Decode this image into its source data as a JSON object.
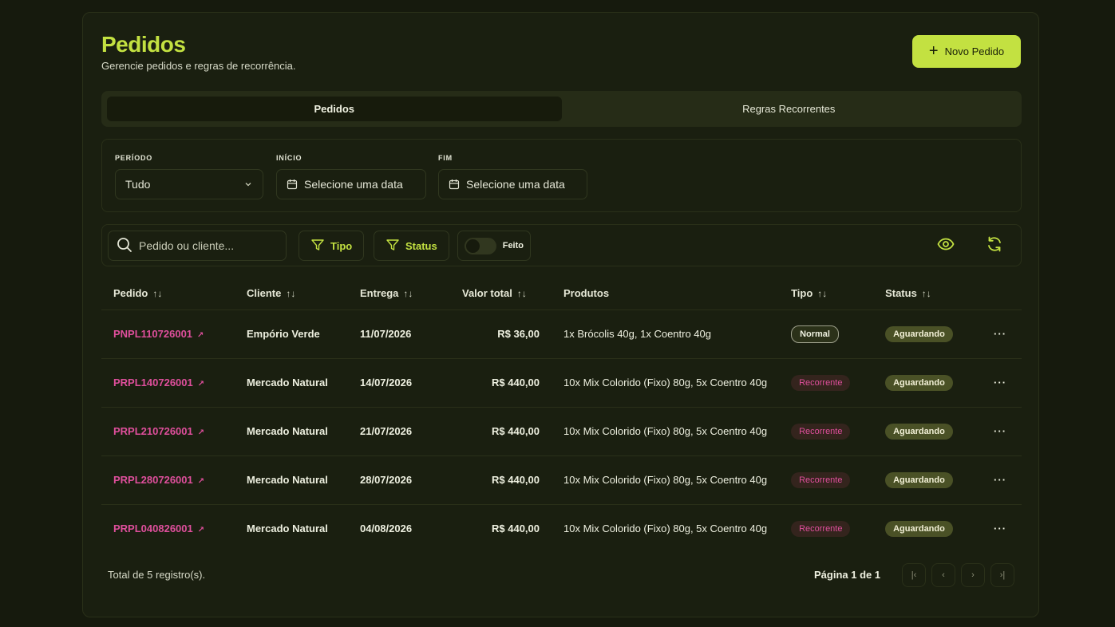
{
  "header": {
    "title": "Pedidos",
    "subtitle": "Gerencie pedidos e regras de recorrência.",
    "new_button_label": "Novo Pedido",
    "new_button_icon": "plus-icon"
  },
  "tabs": [
    {
      "label": "Pedidos",
      "active": true
    },
    {
      "label": "Regras Recorrentes",
      "active": false
    }
  ],
  "filters": {
    "period_label": "PERÍODO",
    "period_value": "Tudo",
    "start_label": "INÍCIO",
    "start_placeholder": "Selecione uma data",
    "end_label": "FIM",
    "end_placeholder": "Selecione uma data"
  },
  "toolbar": {
    "search_placeholder": "Pedido ou cliente...",
    "type_filter": "Tipo",
    "status_filter": "Status",
    "done_toggle_label": "Feito",
    "done_toggle_on": false
  },
  "table": {
    "columns": [
      "Pedido",
      "Cliente",
      "Entrega",
      "Valor total",
      "Produtos",
      "Tipo",
      "Status"
    ],
    "rows": [
      {
        "order": "PNPL110726001",
        "client": "Empório Verde",
        "delivery": "11/07/2026",
        "total": "R$ 36,00",
        "products": "1x Brócolis 40g, 1x Coentro 40g",
        "type": "Normal",
        "status": "Aguardando"
      },
      {
        "order": "PRPL140726001",
        "client": "Mercado Natural",
        "delivery": "14/07/2026",
        "total": "R$ 440,00",
        "products": "10x Mix Colorido (Fixo) 80g, 5x Coentro 40g",
        "type": "Recorrente",
        "status": "Aguardando"
      },
      {
        "order": "PRPL210726001",
        "client": "Mercado Natural",
        "delivery": "21/07/2026",
        "total": "R$ 440,00",
        "products": "10x Mix Colorido (Fixo) 80g, 5x Coentro 40g",
        "type": "Recorrente",
        "status": "Aguardando"
      },
      {
        "order": "PRPL280726001",
        "client": "Mercado Natural",
        "delivery": "28/07/2026",
        "total": "R$ 440,00",
        "products": "10x Mix Colorido (Fixo) 80g, 5x Coentro 40g",
        "type": "Recorrente",
        "status": "Aguardando"
      },
      {
        "order": "PRPL040826001",
        "client": "Mercado Natural",
        "delivery": "04/08/2026",
        "total": "R$ 440,00",
        "products": "10x Mix Colorido (Fixo) 80g, 5x Coentro 40g",
        "type": "Recorrente",
        "status": "Aguardando"
      }
    ]
  },
  "footer": {
    "total_text": "Total de 5 registro(s).",
    "page_text": "Página 1 de 1"
  },
  "colors": {
    "accent": "#c3e141",
    "link": "#df4f9c",
    "background": "#161a0d",
    "card": "#1a1f10"
  }
}
